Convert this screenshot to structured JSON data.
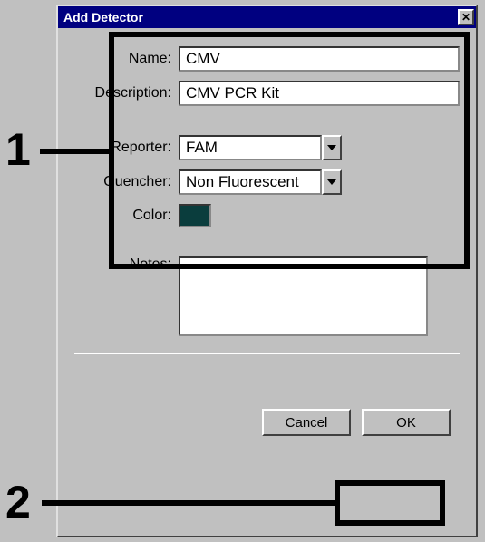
{
  "dialog": {
    "title": "Add Detector",
    "fields": {
      "name": {
        "label": "Name:",
        "value": "CMV"
      },
      "description": {
        "label": "Description:",
        "value": "CMV PCR Kit"
      },
      "reporter": {
        "label": "Reporter:",
        "value": "FAM"
      },
      "quencher": {
        "label": "Quencher:",
        "value": "Non Fluorescent"
      },
      "color": {
        "label": "Color:",
        "value": "#0a3d3d"
      },
      "notes": {
        "label": "Notes:",
        "value": ""
      }
    },
    "buttons": {
      "cancel": "Cancel",
      "ok": "OK"
    }
  },
  "callouts": {
    "one": "1",
    "two": "2"
  }
}
